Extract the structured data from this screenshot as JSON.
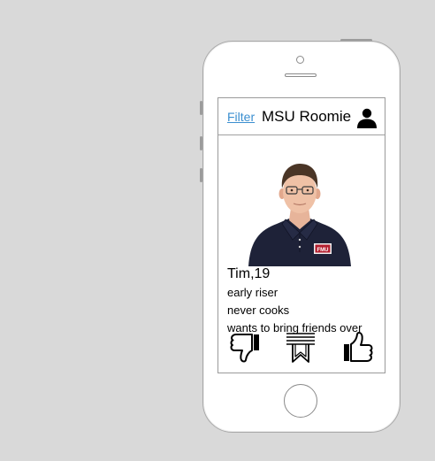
{
  "header": {
    "filter_label": "Filter",
    "title": "MSU Roomie",
    "profile_icon": "person-icon"
  },
  "profile": {
    "photo_badge": "FMU",
    "name_age": "Tim,19",
    "traits": [
      "early riser",
      "never cooks",
      "wants to bring friends over"
    ]
  },
  "actions": {
    "dislike_icon": "thumbs-down-icon",
    "save_icon": "bookmark-icon",
    "like_icon": "thumbs-up-icon"
  }
}
